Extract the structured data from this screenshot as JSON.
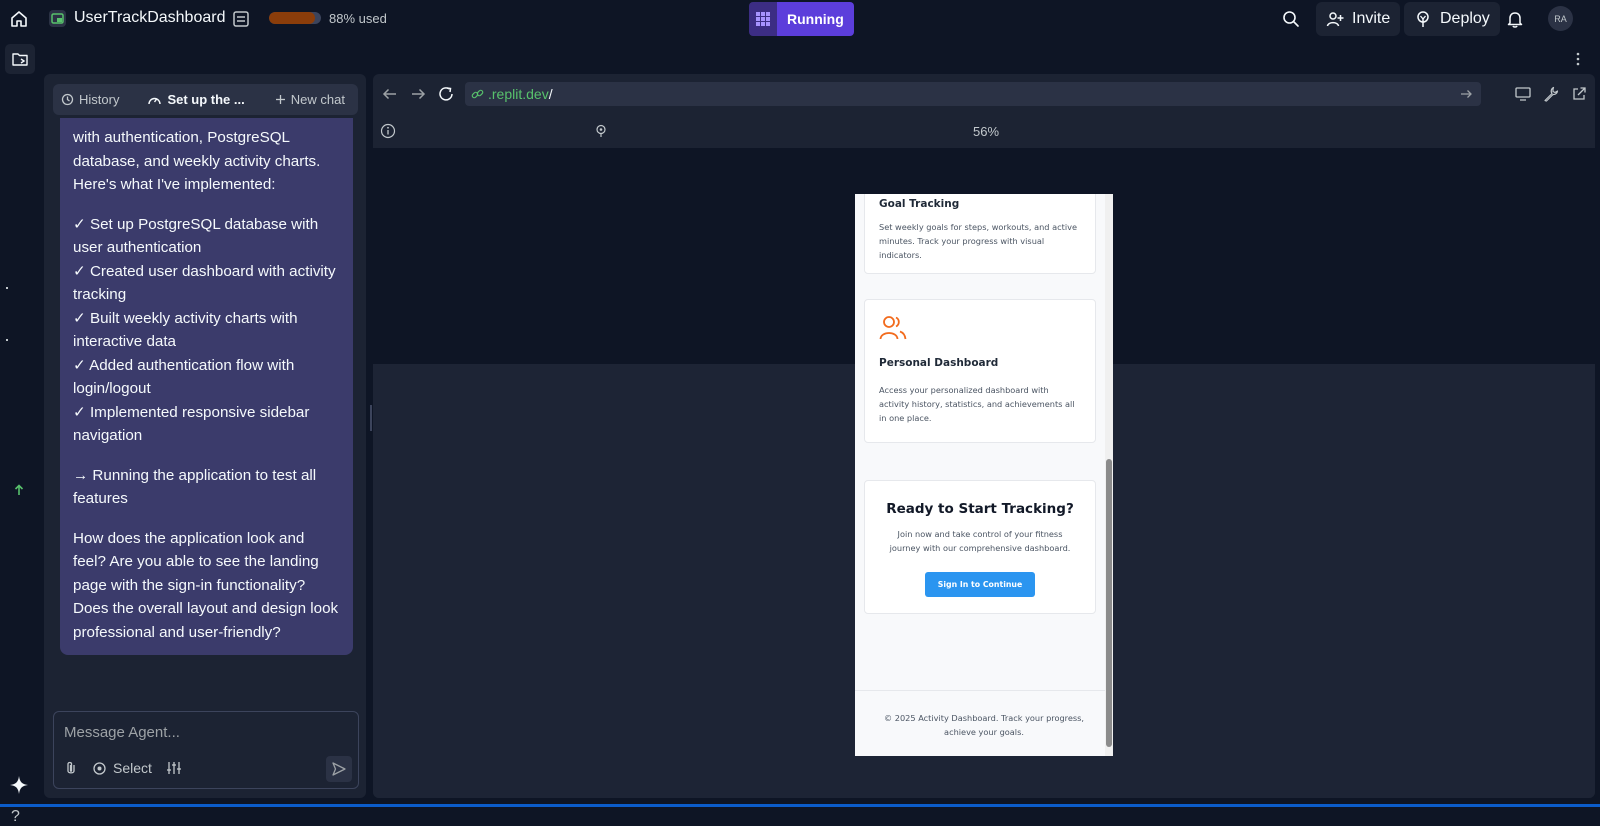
{
  "topbar": {
    "app_name": "UserTrackDashboard",
    "usage": {
      "fraction": 0.88,
      "label": "88% used"
    },
    "run_label": "Running",
    "invite_label": "Invite",
    "deploy_label": "Deploy",
    "avatar_initials": "RA"
  },
  "agent": {
    "tabs": {
      "history": "History",
      "current": "Set up the ...",
      "new_chat": "New chat"
    },
    "message": {
      "intro": "with authentication, PostgreSQL database, and weekly activity charts. Here's what I've implemented:",
      "items": [
        "✓ Set up PostgreSQL database with user authentication",
        "✓ Created user dashboard with activity tracking",
        "✓ Built weekly activity charts with interactive data",
        "✓ Added authentication flow with login/logout",
        "✓ Implemented responsive sidebar navigation"
      ],
      "status": "→ Running the application to test all features",
      "question": "How does the application look and feel? Are you able to see the landing page with the sign-in functionality? Does the overall layout and design look professional and user-friendly?"
    },
    "input": {
      "placeholder": "Message Agent...",
      "select_label": "Select"
    }
  },
  "webview": {
    "url_host": ".replit.dev",
    "url_path": "/",
    "zoom": "56%"
  },
  "preview": {
    "goal_card": {
      "title": "Goal Tracking",
      "text": "Set weekly goals for steps, workouts, and active minutes. Track your progress with visual indicators."
    },
    "dashboard_card": {
      "title": "Personal Dashboard",
      "text": "Access your personalized dashboard with activity history, statistics, and achievements all in one place."
    },
    "cta": {
      "title": "Ready to Start Tracking?",
      "text": "Join now and take control of your fitness journey with our comprehensive dashboard.",
      "button": "Sign In to Continue"
    },
    "footer": "© 2025 Activity Dashboard. Track your progress, achieve your goals."
  },
  "colors": {
    "background": "#0e1525",
    "surface": "#1c2333",
    "running": "#5c3edb",
    "url_host": "#58c26c",
    "agent_bubble": "#3b3b6b",
    "cta_button": "#2b95f0",
    "icon_accent": "#f26b1d"
  }
}
